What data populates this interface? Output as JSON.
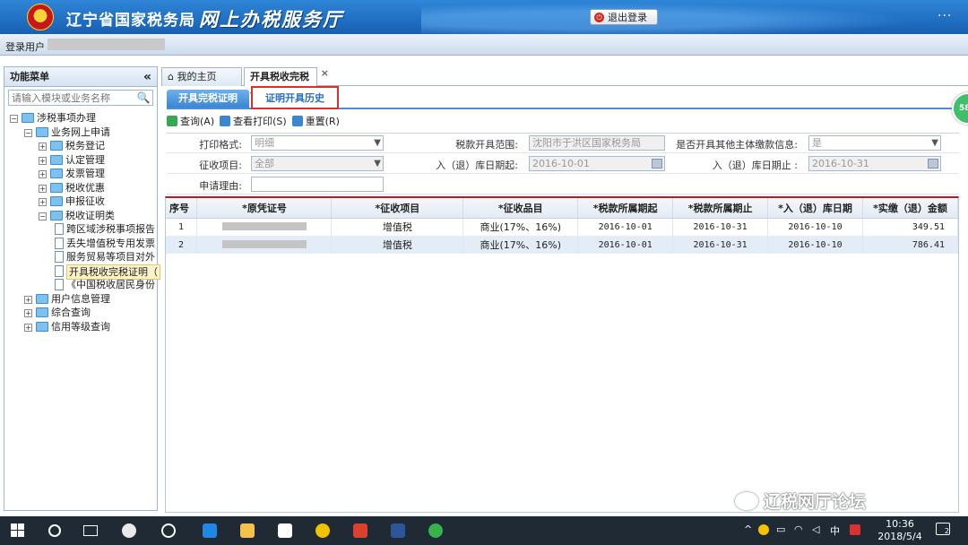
{
  "header": {
    "agency": "辽宁省国家税务局",
    "hall_title": "网上办税服务厅",
    "logout_label": "退出登录",
    "menu_dots": "···"
  },
  "userbar": {
    "label": "登录用户"
  },
  "left_panel": {
    "title": "功能菜单",
    "collapse_glyph": "«",
    "search_placeholder": "请输入模块或业务名称",
    "tree": [
      {
        "label": "涉税事项办理",
        "toggle": "−"
      },
      {
        "label": "业务网上申请",
        "toggle": "−"
      },
      {
        "label": "税务登记",
        "toggle": "+"
      },
      {
        "label": "认定管理",
        "toggle": "+"
      },
      {
        "label": "发票管理",
        "toggle": "+"
      },
      {
        "label": "税收优惠",
        "toggle": "+"
      },
      {
        "label": "申报征收",
        "toggle": "+"
      },
      {
        "label": "税收证明类",
        "toggle": "−"
      },
      {
        "label": "跨区域涉税事项报告"
      },
      {
        "label": "丢失增值税专用发票"
      },
      {
        "label": "服务贸易等项目对外"
      },
      {
        "label": "开具税收完税证明（"
      },
      {
        "label": "《中国税收居民身份"
      },
      {
        "label": "用户信息管理",
        "toggle": "+"
      },
      {
        "label": "综合查询",
        "toggle": "+"
      },
      {
        "label": "信用等级查询",
        "toggle": "+"
      }
    ]
  },
  "tabs": [
    {
      "label": "我的主页"
    },
    {
      "label": "开具税收完税证",
      "close": "×"
    }
  ],
  "inner_tabs": [
    {
      "label": "开具完税证明"
    },
    {
      "label": "证明开具历史"
    }
  ],
  "toolbar": {
    "query": "查询(A)",
    "print": "查看打印(S)",
    "reset": "重置(R)"
  },
  "form": {
    "print_format_label": "打印格式:",
    "print_format_value": "明细",
    "tax_scope_label": "税款开具范围:",
    "tax_scope_value": "沈阳市于洪区国家税务局",
    "other_entity_label": "是否开具其他主体缴款信息:",
    "other_entity_value": "是",
    "levy_item_label": "征收项目:",
    "levy_item_value": "全部",
    "date_start_label": "入（退）库日期起:",
    "date_start_value": "2016-10-01",
    "date_end_label": "入（退）库日期止 :",
    "date_end_value": "2016-10-31",
    "reason_label": "申请理由:"
  },
  "table": {
    "headers": [
      "序号",
      "*原凭证号",
      "*征收项目",
      "*征收品目",
      "*税款所属期起",
      "*税款所属期止",
      "*入（退）库日期",
      "*实缴（退）金额"
    ],
    "rows": [
      {
        "idx": "1",
        "item": "增值税",
        "category": "商业(17%、16%)",
        "start": "2016-10-01",
        "end": "2016-10-31",
        "date": "2016-10-10",
        "amount": "349.51"
      },
      {
        "idx": "2",
        "item": "增值税",
        "category": "商业(17%、16%)",
        "start": "2016-10-01",
        "end": "2016-10-31",
        "date": "2016-10-10",
        "amount": "786.41"
      }
    ]
  },
  "side_badge": "58",
  "watermark": "辽税网厅论坛",
  "taskbar": {
    "ime": "中",
    "time": "10:36",
    "date": "2018/5/4",
    "notifications": "2"
  },
  "colors": {
    "banner": "#1f6fc2",
    "highlight_border": "#d9312f",
    "table_top_border": "#c8161b",
    "alt_row": "#e3ecf7"
  }
}
